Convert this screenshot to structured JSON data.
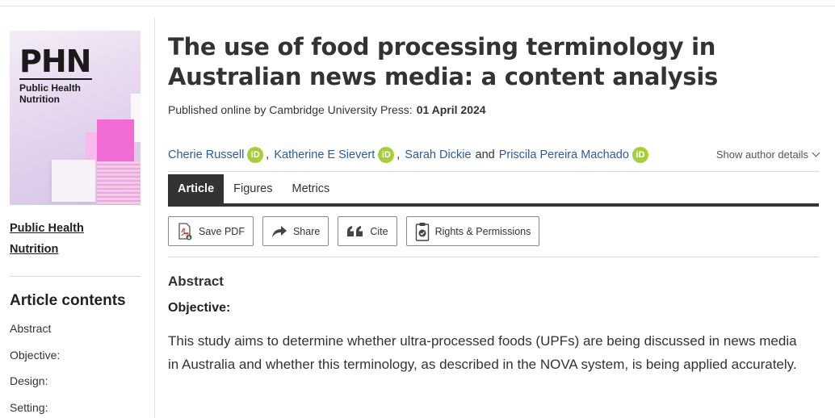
{
  "cover": {
    "logo": "PHN",
    "subtitle_line1": "Public Health",
    "subtitle_line2": "Nutrition",
    "accent_color": "#f06bd4"
  },
  "sidebar": {
    "journal_line1": "Public Health",
    "journal_line2": "Nutrition",
    "contents_title": "Article contents",
    "contents": [
      "Abstract",
      "Objective:",
      "Design:",
      "Setting:"
    ]
  },
  "article": {
    "title": "The use of food processing terminology in Australian news media: a content analysis",
    "published_label": "Published online by Cambridge University Press:",
    "published_date": "01 April 2024",
    "authors": [
      "Cherie Russell",
      "Katherine E Sievert",
      "Sarah Dickie",
      "Priscila Pereira Machado"
    ],
    "author_separator": ",",
    "and_word": "and",
    "orcid_label": "iD",
    "show_details": "Show author details"
  },
  "tabs": [
    "Article",
    "Figures",
    "Metrics"
  ],
  "actions": {
    "save_pdf": "Save PDF",
    "share": "Share",
    "cite": "Cite",
    "rights": "Rights & Permissions"
  },
  "abstract": {
    "heading": "Abstract",
    "objective_heading": "Objective:",
    "objective_text": "This study aims to determine whether ultra-processed foods (UPFs) are being discussed in news media in Australia and whether this terminology, as described in the NOVA system, is being applied accurately."
  },
  "colors": {
    "link": "#2a5d9f",
    "orcid": "#a6ce39",
    "tab_active": "#333333"
  }
}
